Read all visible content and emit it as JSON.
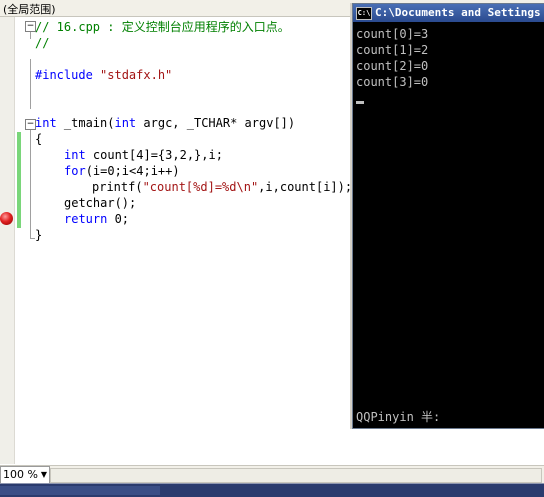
{
  "scope_selector": "(全局范围)",
  "editor": {
    "lines": {
      "l1a": "// 16.cpp : 定义控制台应用程序的入口点。",
      "l2": "//",
      "l4": "#include \"stdafx.h\"",
      "l7a": "int",
      "l7b": " _tmain(",
      "l7c": "int",
      "l7d": " argc, _TCHAR* argv[])",
      "l8": "{",
      "l9a": "int",
      "l9b": " count[4]={3,2,},i;",
      "l10a": "for",
      "l10b": "(i=0;i<4;i++)",
      "l11a": "printf(",
      "l11b": "\"count[%d]=%d\\n\"",
      "l11c": ",i,count[i]);",
      "l12": "getchar();",
      "l13a": "return",
      "l13b": " 0;",
      "l14": "}"
    }
  },
  "console": {
    "title": "C:\\Documents and Settings",
    "icon_label": "C:\\",
    "output": [
      "count[0]=3",
      "count[1]=2",
      "count[2]=0",
      "count[3]=0"
    ],
    "ime_status": "QQPinyin 半:"
  },
  "status": {
    "zoom": "100 %"
  },
  "colors": {
    "keyword": "#0000ff",
    "comment": "#008000",
    "string": "#a31515",
    "breakpoint": "#e02020"
  }
}
